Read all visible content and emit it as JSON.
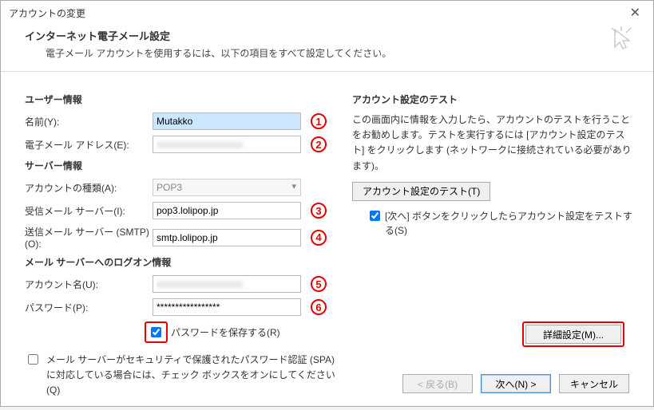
{
  "window": {
    "title": "アカウントの変更"
  },
  "header": {
    "title": "インターネット電子メール設定",
    "subtitle": "電子メール アカウントを使用するには、以下の項目をすべて設定してください。"
  },
  "left": {
    "user_section": "ユーザー情報",
    "name_label": "名前(Y):",
    "name_value": "Mutakko",
    "email_label": "電子メール アドレス(E):",
    "email_value": "xxxxxxxxxxxxxxxxxx",
    "server_section": "サーバー情報",
    "account_type_label": "アカウントの種類(A):",
    "account_type_value": "POP3",
    "incoming_label": "受信メール サーバー(I):",
    "incoming_value": "pop3.lolipop.jp",
    "outgoing_label": "送信メール サーバー (SMTP)(O):",
    "outgoing_value": "smtp.lolipop.jp",
    "logon_section": "メール サーバーへのログオン情報",
    "username_label": "アカウント名(U):",
    "username_value": "xxxxxxxxxxxxxxxxxx",
    "password_label": "パスワード(P):",
    "password_value": "*****************",
    "save_pw_label": "パスワードを保存する(R)",
    "spa_label": "メール サーバーがセキュリティで保護されたパスワード認証 (SPA) に対応している場合には、チェック ボックスをオンにしてください(Q)"
  },
  "right": {
    "test_section": "アカウント設定のテスト",
    "test_desc": "この画面内に情報を入力したら、アカウントのテストを行うことをお勧めします。テストを実行するには [アカウント設定のテスト] をクリックします (ネットワークに接続されている必要があります)。",
    "test_button": "アカウント設定のテスト(T)",
    "test_on_next_label": "[次へ] ボタンをクリックしたらアカウント設定をテストする(S)",
    "detail_button": "詳細設定(M)..."
  },
  "footer": {
    "back": "< 戻る(B)",
    "next": "次へ(N) >",
    "cancel": "キャンセル"
  },
  "badges": {
    "b1": "1",
    "b2": "2",
    "b3": "3",
    "b4": "4",
    "b5": "5",
    "b6": "6"
  }
}
